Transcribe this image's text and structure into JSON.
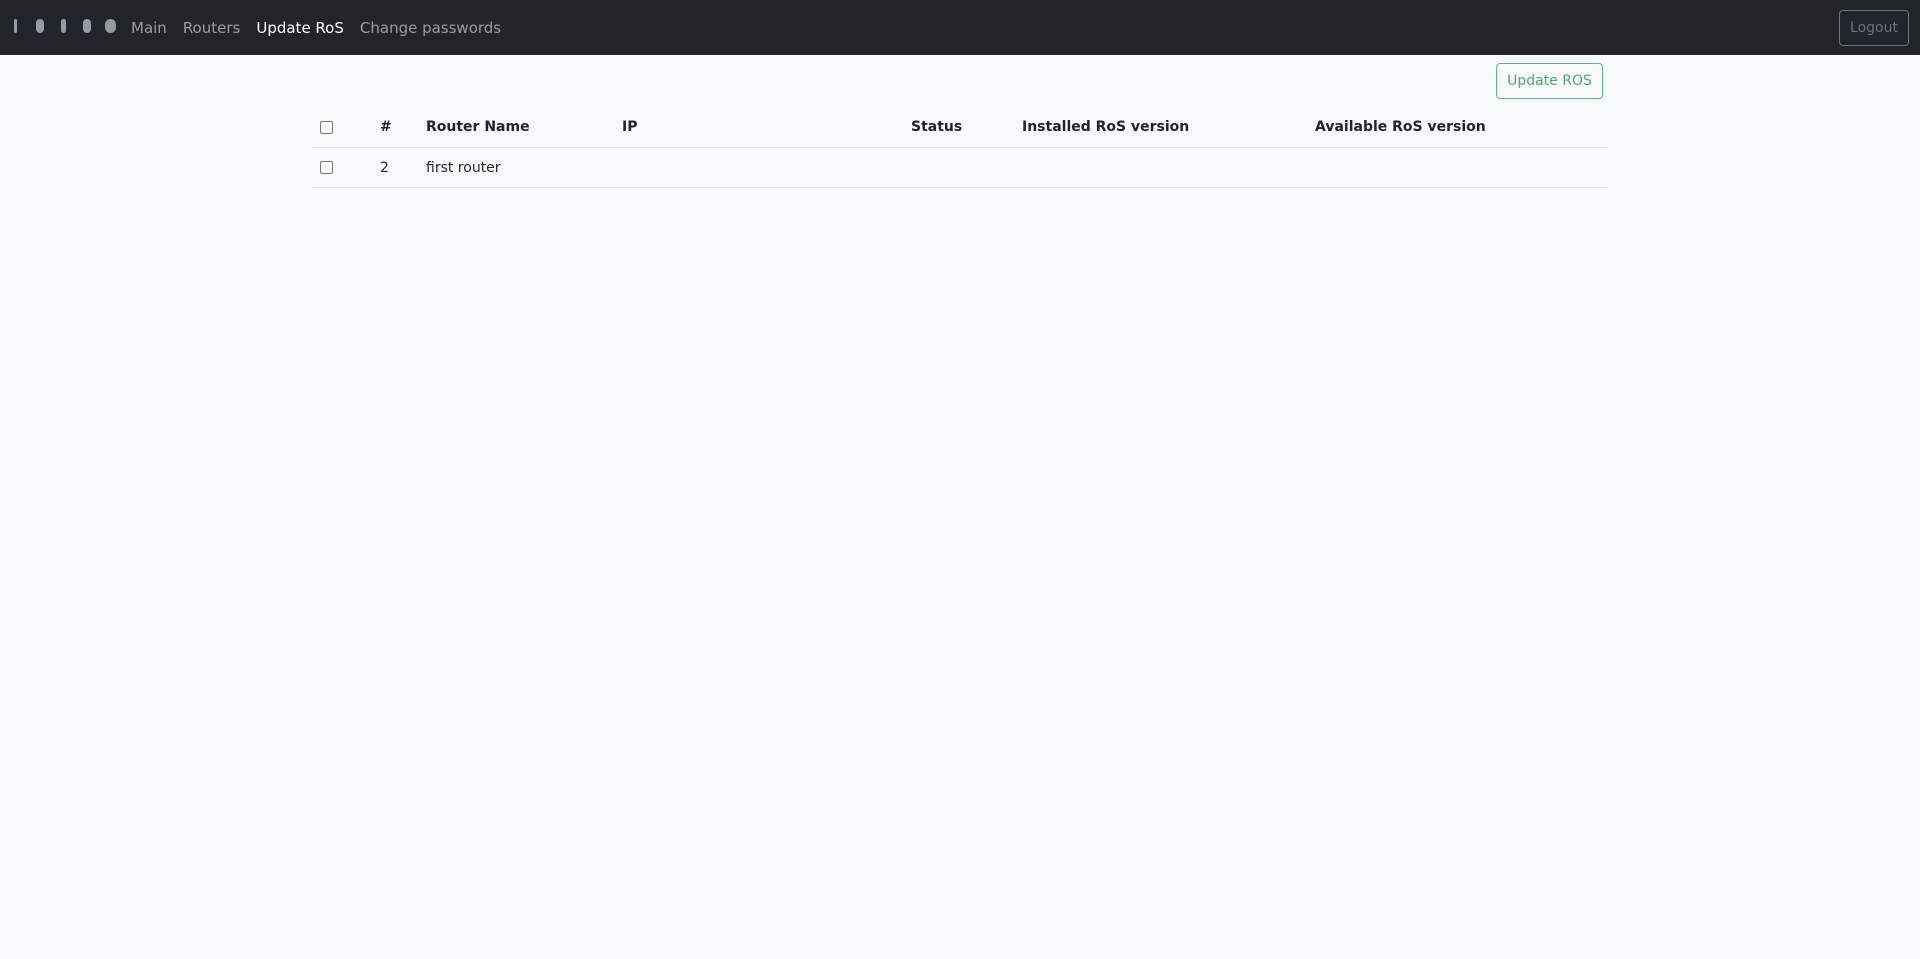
{
  "navbar": {
    "brand_icon": "logo-icon",
    "links": [
      {
        "label": "Main",
        "active": false
      },
      {
        "label": "Routers",
        "active": false
      },
      {
        "label": "Update RoS",
        "active": true
      },
      {
        "label": "Change passwords",
        "active": false
      }
    ],
    "logout_label": "Logout"
  },
  "toolbar": {
    "update_label": "Update ROS"
  },
  "table": {
    "headers": [
      "#",
      "Router Name",
      "IP",
      "Status",
      "Installed RoS version",
      "Available RoS version"
    ],
    "rows": [
      {
        "id": "2",
        "name": "first router",
        "ip": "",
        "status": "",
        "installed": "",
        "available": ""
      }
    ]
  },
  "colors": {
    "navbar_bg": "#212529",
    "page_bg": "#f8f9fa",
    "accent_green": "#5cb88a"
  }
}
